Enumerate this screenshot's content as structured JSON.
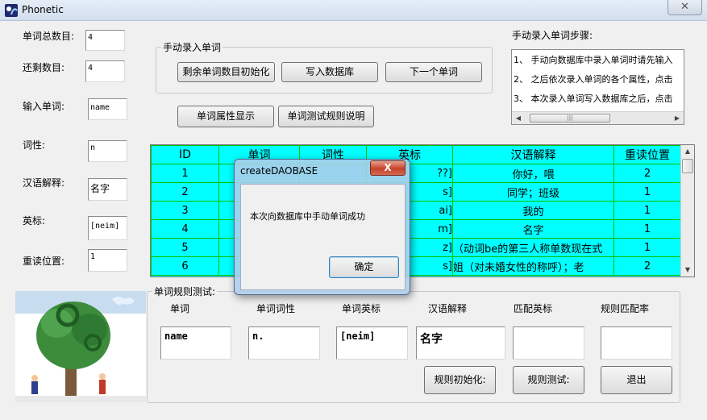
{
  "window": {
    "title": "Phonetic",
    "close_glyph": "✕"
  },
  "fields": {
    "total_label": "单词总数目:",
    "total_value": "4",
    "remain_label": "还剩数目:",
    "remain_value": "4",
    "word_label": "输入单词:",
    "word_value": "name",
    "pos_label": "词性:",
    "pos_value": "n",
    "meaning_label": "汉语解释:",
    "meaning_value": "名字",
    "phonetic_label": "英标:",
    "phonetic_value": "[neim]",
    "stress_label": "重读位置:",
    "stress_value": "1"
  },
  "manual_group": {
    "title": "手动录入单词",
    "init_button": "剩余单词数目初始化",
    "write_button": "写入数据库",
    "next_button": "下一个单词"
  },
  "buttons": {
    "show_attributes": "单词属性显示",
    "rules_info": "单词测试规则说明"
  },
  "steps": {
    "title": "手动录入单词步骤:",
    "items": [
      "1、 手动向数据库中录入单词时请先输入",
      "2、 之后依次录入单词的各个属性，点击",
      "3、 本次录入单词写入数据库之后，点击"
    ],
    "scroll_left_icon": "◀",
    "scroll_right_icon": "▶",
    "thumb_grip": "|||"
  },
  "grid": {
    "columns": [
      "ID",
      "单词",
      "词性",
      "英标",
      "汉语解释",
      "重读位置"
    ],
    "rows": [
      [
        "1",
        "",
        "",
        "??]",
        "你好，喂",
        "2"
      ],
      [
        "2",
        "",
        "",
        "s]",
        "同学；班级",
        "1"
      ],
      [
        "3",
        "",
        "",
        "ai]",
        "我的",
        "1"
      ],
      [
        "4",
        "",
        "",
        "m]",
        "名字",
        "1"
      ],
      [
        "5",
        "",
        "",
        "z]",
        "（动词be的第三人称单数现在式",
        "1"
      ],
      [
        "6",
        "",
        "",
        "s]",
        "姐（对未婚女性的称呼）；老",
        "2"
      ]
    ],
    "scroll_up_icon": "▲",
    "scroll_down_icon": "▼"
  },
  "rule_test": {
    "title": "单词规则测试:",
    "headers": [
      "单词",
      "单词词性",
      "单词英标",
      "汉语解释",
      "匹配英标",
      "规则匹配率"
    ],
    "values": [
      "name",
      "n.",
      "[neim]",
      "名字",
      "",
      ""
    ],
    "init_button": "规则初始化:",
    "test_button": "规则测试:",
    "exit_button": "退出"
  },
  "dialog": {
    "title": "createDAOBASE",
    "message": "本次向数据库中手动单词成功",
    "ok_button": "确定",
    "close_glyph": "X"
  }
}
